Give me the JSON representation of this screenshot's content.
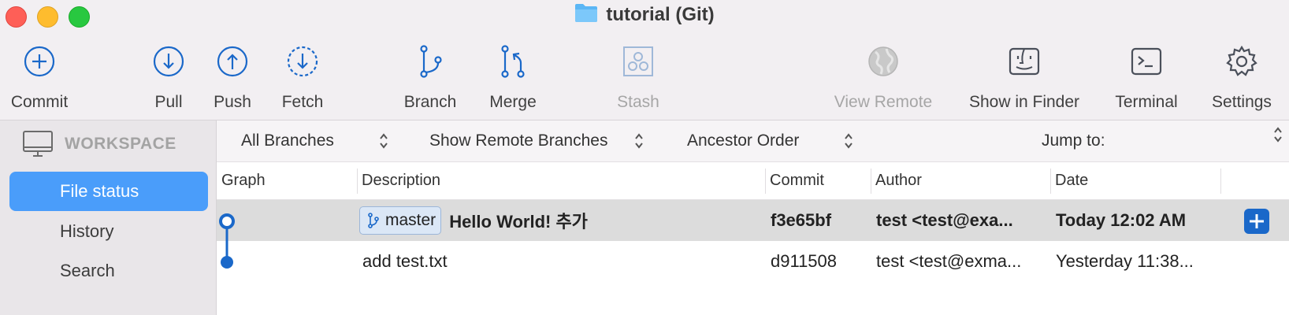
{
  "window": {
    "title": "tutorial (Git)"
  },
  "toolbar": {
    "commit": "Commit",
    "pull": "Pull",
    "push": "Push",
    "fetch": "Fetch",
    "branch": "Branch",
    "merge": "Merge",
    "stash": "Stash",
    "view_remote": "View Remote",
    "show_in_finder": "Show in Finder",
    "terminal": "Terminal",
    "settings": "Settings"
  },
  "sidebar": {
    "section": "WORKSPACE",
    "items": [
      {
        "label": "File status",
        "active": true
      },
      {
        "label": "History",
        "active": false
      },
      {
        "label": "Search",
        "active": false
      }
    ]
  },
  "filters": {
    "branches": "All Branches",
    "remote": "Show Remote Branches",
    "order": "Ancestor Order",
    "jump_to": "Jump to:"
  },
  "columns": {
    "graph": "Graph",
    "description": "Description",
    "commit": "Commit",
    "author": "Author",
    "date": "Date"
  },
  "commits": [
    {
      "branch_tag": "master",
      "description": "Hello World! 추가",
      "commit": "f3e65bf",
      "author": "test <test@exa...",
      "date": "Today 12:02 AM"
    },
    {
      "description": "add test.txt",
      "commit": "d911508",
      "author": "test <test@exma...",
      "date": "Yesterday 11:38..."
    }
  ],
  "colors": {
    "accent": "#4a9dfa",
    "icon_blue": "#1a68c9",
    "selected_row": "#dcdcdc",
    "sidebar_bg": "#e9e6e9",
    "toolbar_bg": "#f2eff2"
  }
}
